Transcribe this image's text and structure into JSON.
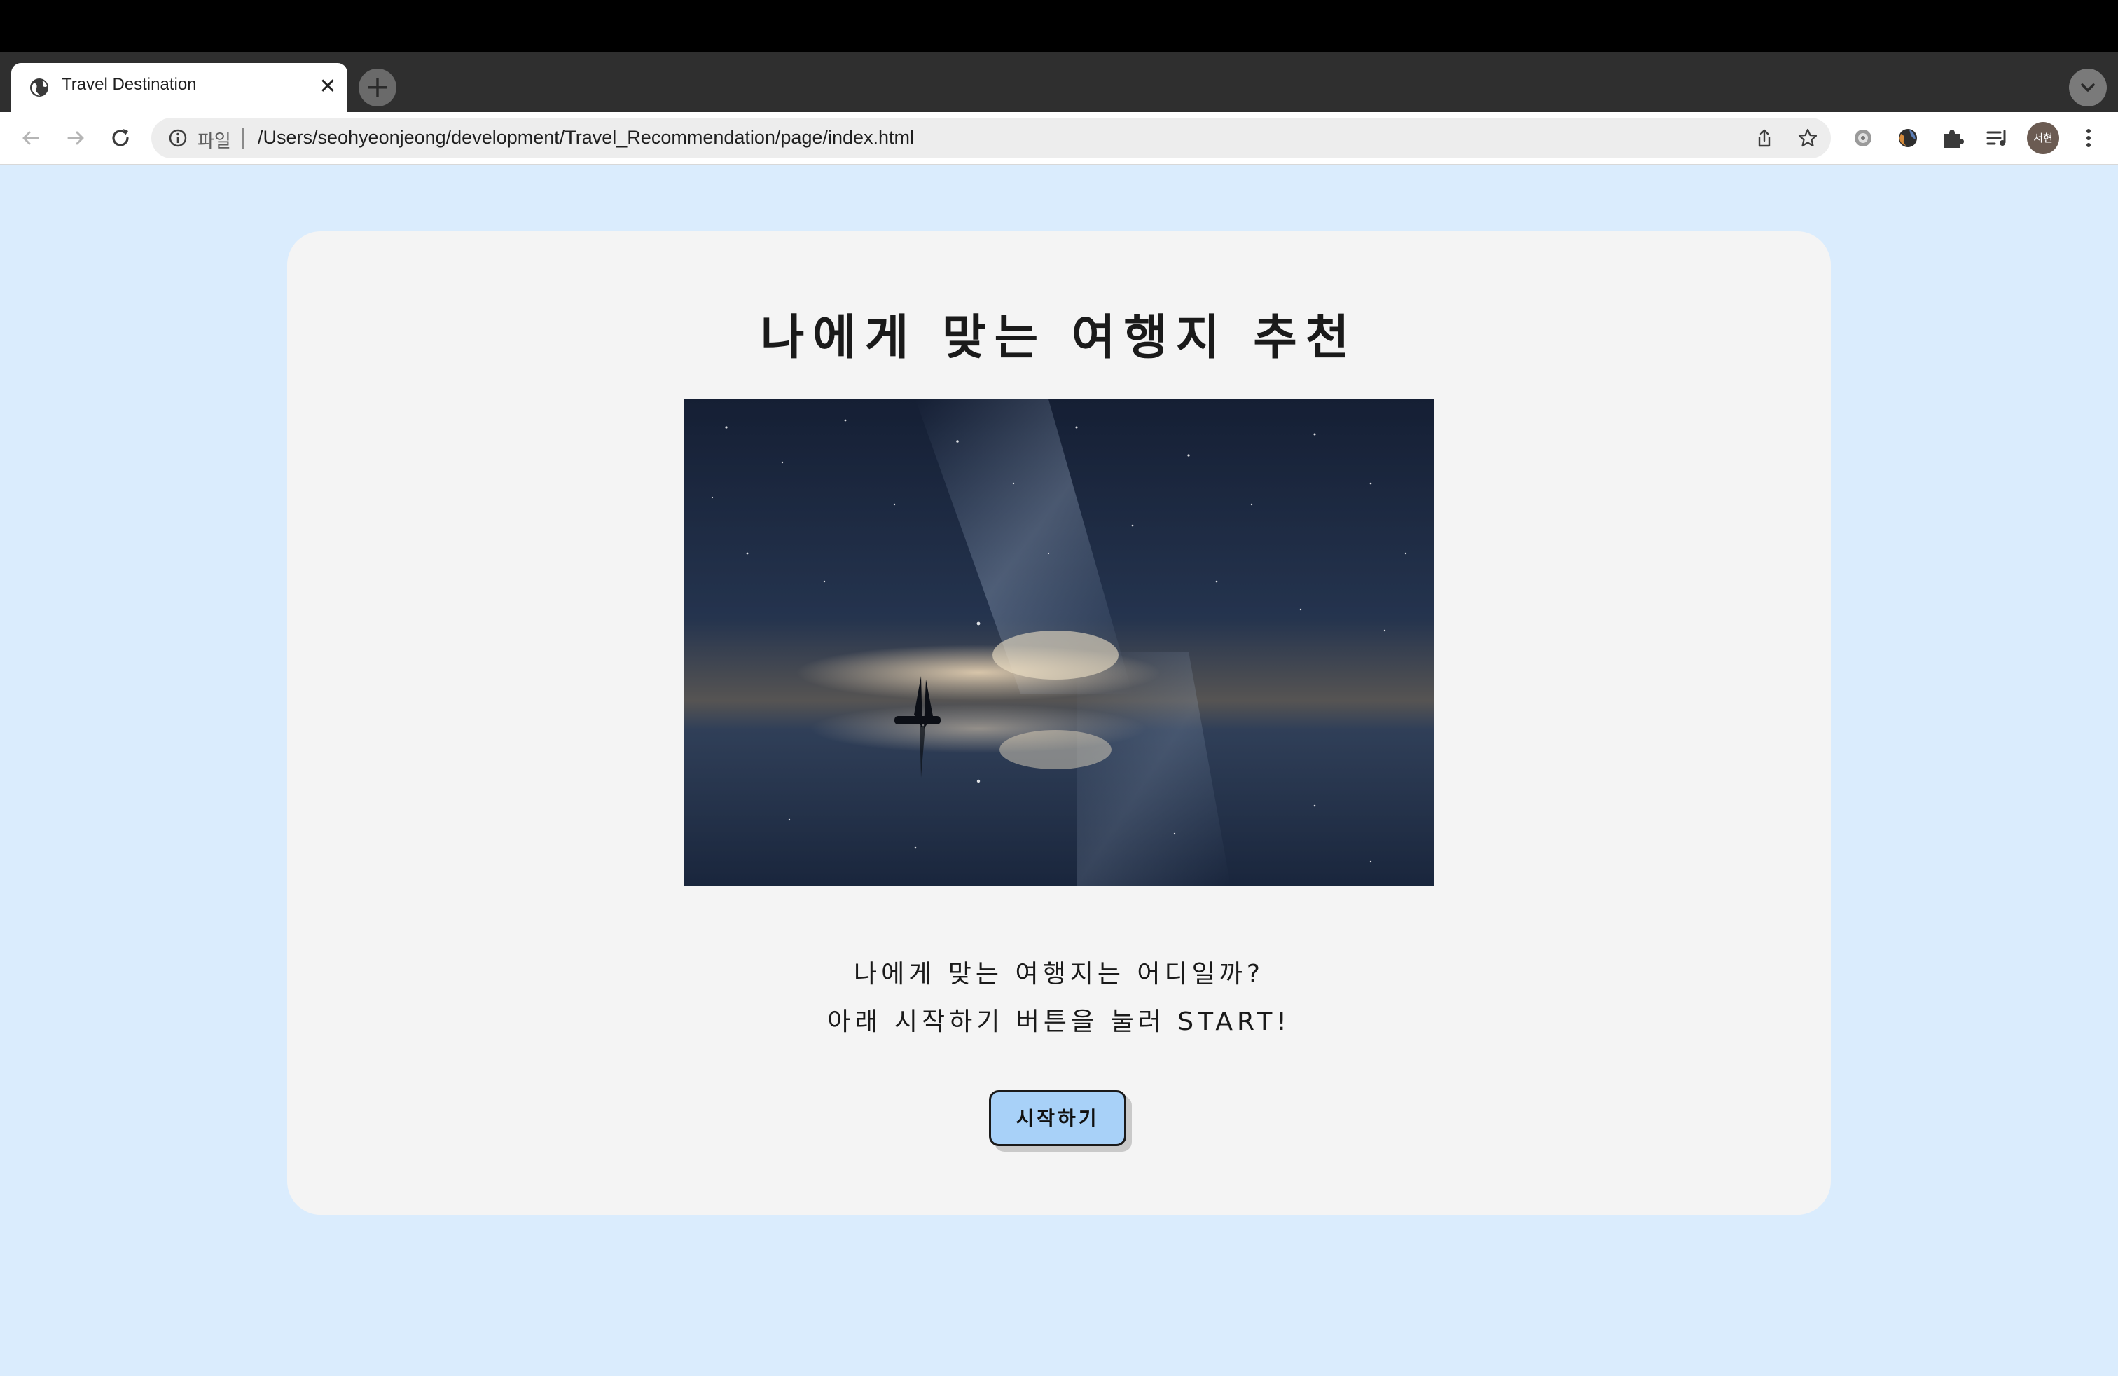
{
  "browser": {
    "tab_title": "Travel Destination",
    "tab_close": "✕",
    "new_tab": "+",
    "scheme_label": "파일",
    "url": "/Users/seohyeonjeong/development/Travel_Recommendation/page/index.html",
    "avatar_text": "서현"
  },
  "page": {
    "title": "나에게 맞는 여행지 추천",
    "desc_line1": "나에게 맞는 여행지는 어디일까?",
    "desc_line2": "아래 시작하기 버튼을 눌러 START!",
    "start_button": "시작하기"
  },
  "colors": {
    "background": "#daecfd",
    "card": "#f4f4f4",
    "button": "#a8d1f8"
  }
}
